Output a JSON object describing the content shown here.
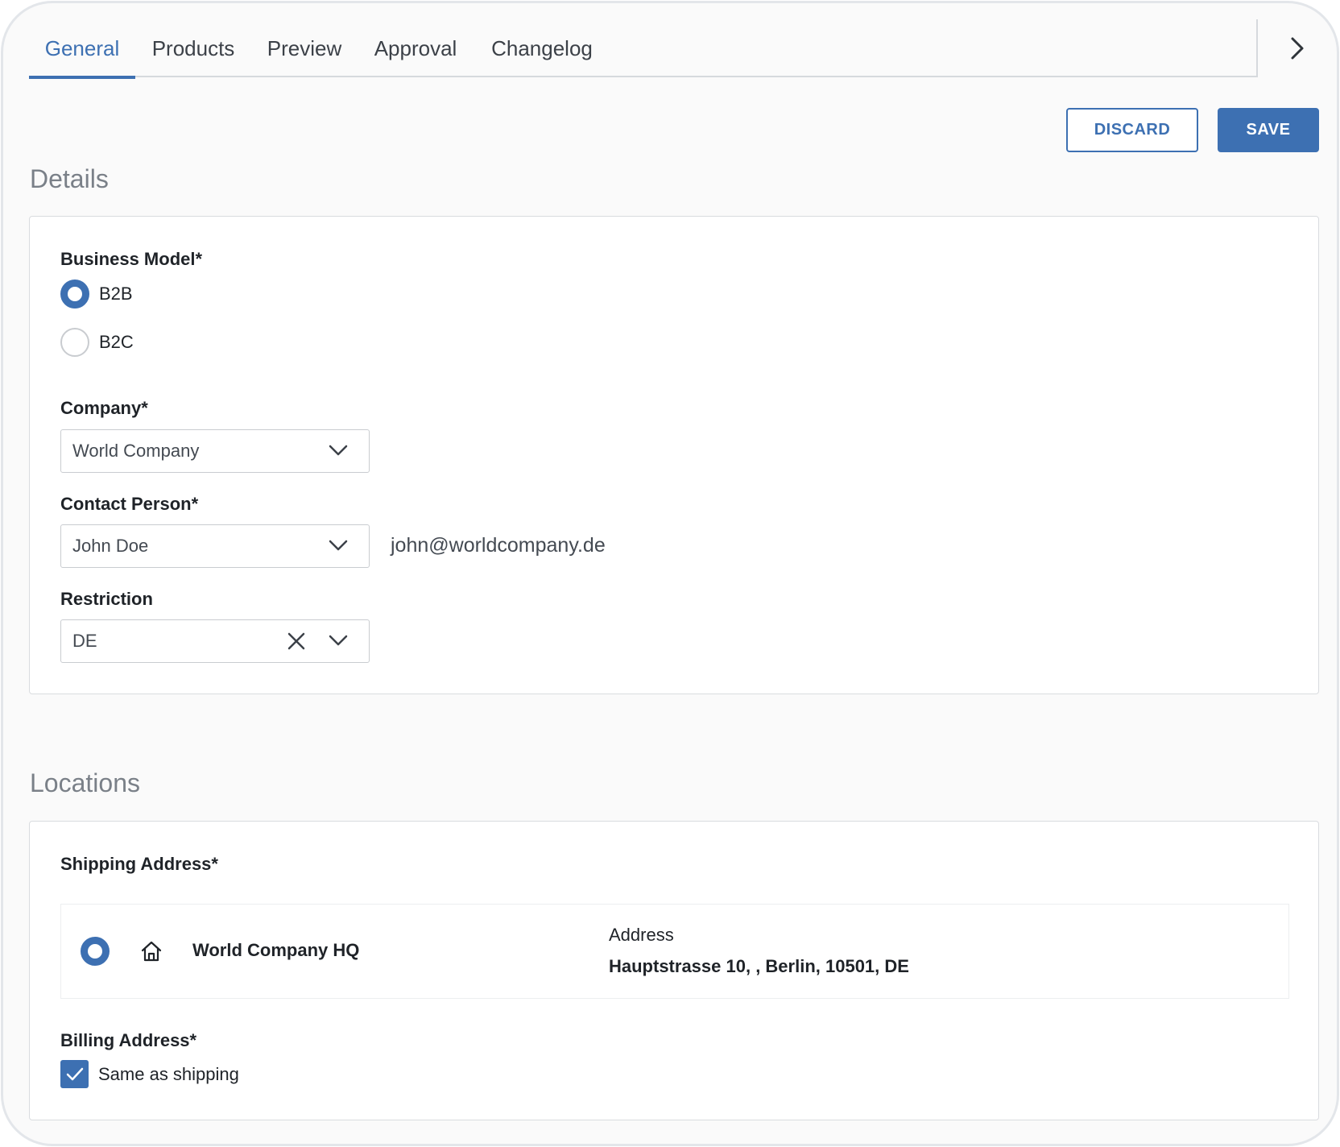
{
  "tabs": [
    {
      "label": "General",
      "active": true
    },
    {
      "label": "Products",
      "active": false
    },
    {
      "label": "Preview",
      "active": false
    },
    {
      "label": "Approval",
      "active": false
    },
    {
      "label": "Changelog",
      "active": false
    }
  ],
  "toolbar": {
    "discard_label": "DISCARD",
    "save_label": "SAVE"
  },
  "details": {
    "title": "Details",
    "business_model": {
      "label": "Business Model*",
      "options": [
        {
          "label": "B2B",
          "selected": true
        },
        {
          "label": "B2C",
          "selected": false
        }
      ]
    },
    "company": {
      "label": "Company*",
      "value": "World Company"
    },
    "contact": {
      "label": "Contact Person*",
      "value": "John Doe",
      "email": "john@worldcompany.de"
    },
    "restriction": {
      "label": "Restriction",
      "value": "DE"
    }
  },
  "locations": {
    "title": "Locations",
    "shipping": {
      "label": "Shipping Address*",
      "name": "World Company HQ",
      "address_label": "Address",
      "address": "Hauptstrasse 10, , Berlin, 10501, DE"
    },
    "billing": {
      "label": "Billing Address*",
      "same_as_shipping_label": "Same as shipping",
      "same_as_shipping": true
    }
  },
  "colors": {
    "accent": "#3d70b2",
    "border": "#d9dcdf",
    "background": "#fafafa"
  },
  "icons": [
    "chevron-right-icon",
    "chevron-down-icon",
    "close-icon",
    "home-icon",
    "checkmark-icon"
  ]
}
